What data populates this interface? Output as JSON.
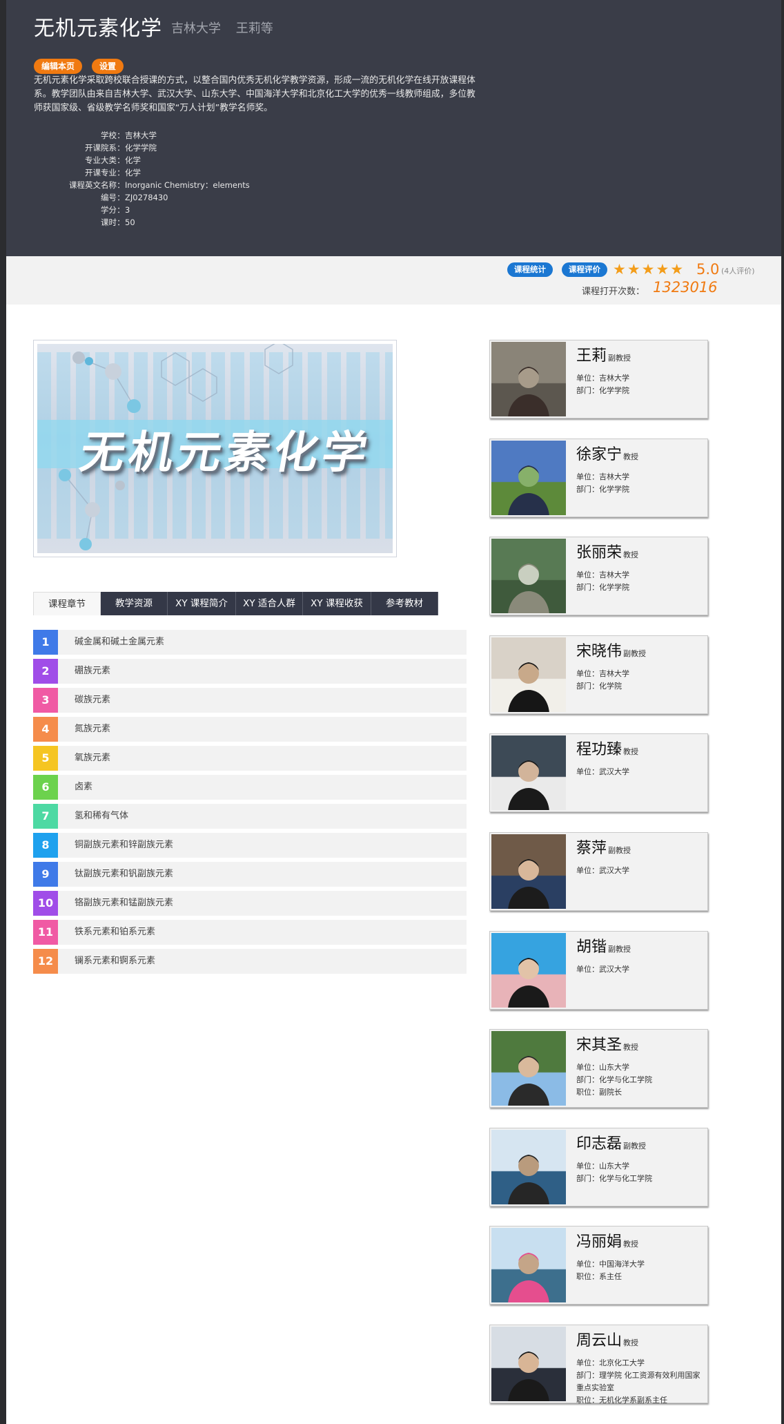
{
  "course": {
    "title": "无机元素化学",
    "school": "吉林大学",
    "teachers_short": "王莉等",
    "edit_label": "编辑本页",
    "settings_label": "设置",
    "intro": "无机元素化学采取跨校联合授课的方式，以整合国内优秀无机化学教学资源，形成一流的无机化学在线开放课程体系。教学团队由来自吉林大学、武汉大学、山东大学、中国海洋大学和北京化工大学的优秀一线教师组成，多位教师获国家级、省级教学名师奖和国家“万人计划”教学名师奖。",
    "sep": "："
  },
  "info": [
    {
      "label": "学校",
      "value": "吉林大学"
    },
    {
      "label": "开课院系",
      "value": "化学学院"
    },
    {
      "label": "专业大类",
      "value": "化学"
    },
    {
      "label": "开课专业",
      "value": "化学"
    },
    {
      "label": "课程英文名称",
      "value": "Inorganic Chemistry：elements"
    },
    {
      "label": "编号",
      "value": "ZJ0278430"
    },
    {
      "label": "学分",
      "value": "3"
    },
    {
      "label": "课时",
      "value": "50"
    }
  ],
  "stats": {
    "stats_label": "课程统计",
    "review_label": "课程评价",
    "stars": "★★★★★",
    "score": "5.0",
    "score_count": "(4人评价)",
    "opens_label": "课程打开次数：",
    "opens_value": "1323016",
    "star_color": "#f39d1a",
    "accent": "#f07a11"
  },
  "cover": {
    "title": "无机元素化学"
  },
  "tabs": [
    "课程章节",
    "教学资源",
    "XY 课程简介",
    "XY 适合人群",
    "XY 课程收获",
    "参考教材"
  ],
  "chapters": [
    {
      "num": "1",
      "title": "碱金属和碱土金属元素",
      "color": "#3f7ae8"
    },
    {
      "num": "2",
      "title": "硼族元素",
      "color": "#a04de8"
    },
    {
      "num": "3",
      "title": "碳族元素",
      "color": "#f05aa4"
    },
    {
      "num": "4",
      "title": "氮族元素",
      "color": "#f58c4b"
    },
    {
      "num": "5",
      "title": "氧族元素",
      "color": "#f5c522"
    },
    {
      "num": "6",
      "title": "卤素",
      "color": "#6cd24d"
    },
    {
      "num": "7",
      "title": "氢和稀有气体",
      "color": "#4dd9a3"
    },
    {
      "num": "8",
      "title": "铜副族元素和锌副族元素",
      "color": "#1ea1ee"
    },
    {
      "num": "9",
      "title": "钛副族元素和钒副族元素",
      "color": "#3f7ae8"
    },
    {
      "num": "10",
      "title": "铬副族元素和锰副族元素",
      "color": "#a04de8"
    },
    {
      "num": "11",
      "title": "铁系元素和铂系元素",
      "color": "#f05aa4"
    },
    {
      "num": "12",
      "title": "镧系元素和锕系元素",
      "color": "#f58c4b"
    }
  ],
  "teachers": [
    {
      "name": "王莉",
      "title": "副教授",
      "lines": [
        "单位：吉林大学",
        "部门：化学学院"
      ]
    },
    {
      "name": "徐家宁",
      "title": "教授",
      "lines": [
        "单位：吉林大学",
        "部门：化学学院"
      ]
    },
    {
      "name": "张丽荣",
      "title": "教授",
      "lines": [
        "单位：吉林大学",
        "部门：化学学院"
      ]
    },
    {
      "name": "宋晓伟",
      "title": "副教授",
      "lines": [
        "单位：吉林大学",
        "部门：化学院"
      ]
    },
    {
      "name": "程功臻",
      "title": "教授",
      "lines": [
        "单位：武汉大学"
      ]
    },
    {
      "name": "蔡萍",
      "title": "副教授",
      "lines": [
        "单位：武汉大学"
      ]
    },
    {
      "name": "胡锴",
      "title": "副教授",
      "lines": [
        "单位：武汉大学"
      ]
    },
    {
      "name": "宋其圣",
      "title": "教授",
      "lines": [
        "单位：山东大学",
        "部门：化学与化工学院",
        "职位：副院长"
      ]
    },
    {
      "name": "印志磊",
      "title": "副教授",
      "lines": [
        "单位：山东大学",
        "部门：化学与化工学院"
      ]
    },
    {
      "name": "冯丽娟",
      "title": "教授",
      "lines": [
        "单位：中国海洋大学",
        "职位：系主任"
      ]
    },
    {
      "name": "周云山",
      "title": "教授",
      "lines": [
        "单位：北京化工大学",
        "部门：理学院 化工资源有效利用国家重点实验室",
        "职位：无机化学系副系主任"
      ]
    }
  ]
}
